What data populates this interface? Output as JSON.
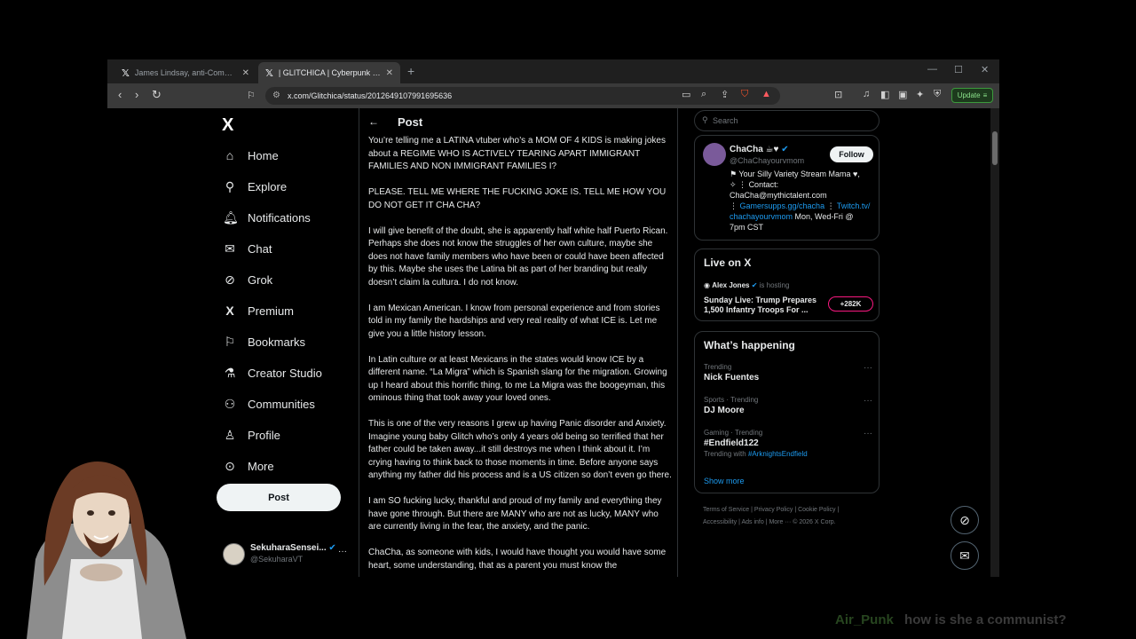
{
  "browser": {
    "tabs": [
      {
        "title": "James Lindsay, anti-Communist on X",
        "active": false
      },
      {
        "title": "| GLITCHICA | Cyberpunk Vtuber",
        "active": true
      }
    ],
    "new_tab_label": "+",
    "url": "x.com/Glitchica/status/2012649107991695636",
    "update_label": "Update"
  },
  "sidebar": {
    "logo": "X",
    "items": [
      {
        "label": "Home",
        "icon": "home-icon"
      },
      {
        "label": "Explore",
        "icon": "search-icon"
      },
      {
        "label": "Notifications",
        "icon": "bell-icon"
      },
      {
        "label": "Chat",
        "icon": "mail-icon"
      },
      {
        "label": "Grok",
        "icon": "grok-icon"
      },
      {
        "label": "Premium",
        "icon": "x-icon"
      },
      {
        "label": "Bookmarks",
        "icon": "bookmark-icon"
      },
      {
        "label": "Creator Studio",
        "icon": "flask-icon"
      },
      {
        "label": "Communities",
        "icon": "people-icon"
      },
      {
        "label": "Profile",
        "icon": "person-icon"
      },
      {
        "label": "More",
        "icon": "more-circle-icon"
      }
    ],
    "post_button": "Post",
    "account": {
      "name": "SekuharaSensei...",
      "handle": "@SekuharaVT",
      "more": "···"
    }
  },
  "post": {
    "header_title": "Post",
    "paragraphs": [
      "You’re telling me a LATINA vtuber who’s a MOM OF 4 KIDS is making jokes about a REGIME WHO IS ACTIVELY TEARING APART IMMIGRANT FAMILIES AND NON IMMIGRANT FAMILIES I?",
      "PLEASE. TELL ME WHERE THE FUCKING JOKE IS. TELL ME HOW YOU DO NOT GET IT CHA CHA?",
      "I will give benefit of the doubt, she is apparently half white half Puerto Rican. Perhaps she does not know the struggles of her own culture, maybe she does not have family members who have been or could have been affected by this. Maybe she uses the Latina bit as part of her branding but really doesn’t claim la cultura. I do not know.",
      "I am Mexican American. I know from personal experience and from stories told in my family the hardships and very real reality of what ICE is. Let me give you a little history lesson.",
      "In Latin culture or at least Mexicans in the states would know ICE by a different name. “La Migra” which is Spanish slang for the migration. Growing up I heard about this horrific thing, to me La Migra was the boogeyman, this ominous thing that took away your loved ones.",
      "This is one of the very reasons I grew up having Panic disorder and Anxiety. Imagine young baby Glitch who’s only 4 years old being so terrified that her father could be taken away...it still destroys me when I think about it. I’m crying having to think back to those moments in time. Before anyone says anything my father did his process and is a US citizen so don’t even go there.",
      "I am SO fucking lucky, thankful and proud of my family and everything they have gone through. But there are MANY who are not as lucky, MANY who are currently living in the fear, the anxiety, and the panic.",
      "ChaCha, as someone with kids, I would have thought you would have some heart, some understanding, that as a parent you must know the"
    ]
  },
  "right": {
    "search_placeholder": "Search",
    "profile": {
      "name": "ChaCha",
      "handle": "@ChaChayourvmom",
      "follow_label": "Follow",
      "bio_line1": "Your Silly Variety Stream Mama",
      "bio_contact": "Contact:",
      "bio_email": "ChaCha@mythictalent.com",
      "bio_link1": "Gamersupps.gg/chacha",
      "bio_link2": "Twitch.tv/",
      "bio_link3": "chachayourvmom",
      "bio_schedule": "Mon, Wed-Fri @",
      "bio_time": "7pm CST"
    },
    "live": {
      "heading": "Live on X",
      "host_name": "Alex Jones",
      "host_action": "is hosting",
      "title": "Sunday Live: Trump Prepares 1,500 Infantry Troops For ...",
      "count": "+282K"
    },
    "happening": {
      "heading": "What’s happening",
      "trends": [
        {
          "meta": "Trending",
          "name": "Nick Fuentes",
          "sub": ""
        },
        {
          "meta": "Sports · Trending",
          "name": "DJ Moore",
          "sub": ""
        },
        {
          "meta": "Gaming · Trending",
          "name": "#Endfield122",
          "sub_prefix": "Trending with",
          "sub_link": "#ArknightsEndfield"
        }
      ],
      "show_more": "Show more"
    },
    "footer": {
      "line1": "Terms of Service  |  Privacy Policy  |  Cookie Policy  |",
      "line2": "Accessibility  |  Ads info  |  More ···  © 2026 X Corp."
    }
  },
  "chat_overlay": {
    "user": "Air_Punk",
    "message": "how is she a communist?"
  },
  "colors": {
    "accent": "#1d9bf0",
    "background": "#000000",
    "text": "#e7e9ea",
    "muted": "#71767b",
    "live_border": "#f91880",
    "update_green": "#8be28b"
  }
}
